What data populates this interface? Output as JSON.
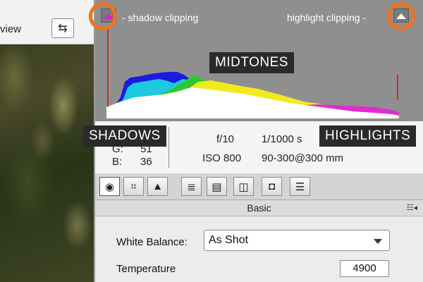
{
  "toolbar": {
    "preview_label": "view"
  },
  "histogram": {
    "shadow_clipping_label": "- shadow clipping",
    "highlight_clipping_label": "highlight clipping -",
    "shadow_warning_color": "#d424d4",
    "highlight_warning_color": "#ffffff"
  },
  "annotations": {
    "midtones": "MIDTONES",
    "shadows": "SHADOWS",
    "highlights": "HIGHLIGHTS",
    "ring_color": "#f0721e"
  },
  "readout": {
    "g_label": "G:",
    "g_value": "51",
    "b_label": "B:",
    "b_value": "36"
  },
  "exif": {
    "aperture": "f/10",
    "shutter": "1/1000 s",
    "iso": "ISO 800",
    "lens": "90-300@300 mm"
  },
  "panel_tabs": [
    {
      "icon": "aperture-icon",
      "active": true
    },
    {
      "icon": "tone-curve-icon"
    },
    {
      "icon": "detail-icon"
    },
    {
      "icon": "hsl-icon"
    },
    {
      "icon": "split-toning-icon"
    },
    {
      "icon": "lens-corrections-icon"
    },
    {
      "icon": "camera-calibration-icon"
    },
    {
      "icon": "presets-icon"
    }
  ],
  "section": {
    "title": "Basic"
  },
  "white_balance": {
    "label": "White Balance:",
    "value": "As Shot"
  },
  "temperature": {
    "label": "Temperature",
    "value": "4900"
  }
}
